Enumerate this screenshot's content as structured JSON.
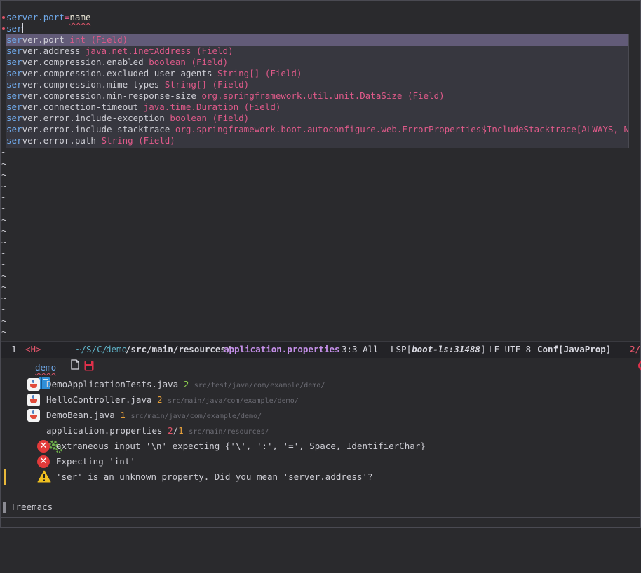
{
  "editor": {
    "line1": {
      "key": "server",
      "dot": ".",
      "key2": "port",
      "eq": "=",
      "value": "name"
    },
    "line2": {
      "text": "ser"
    },
    "completions": [
      {
        "match": "ser",
        "rest": "ver.port",
        "type": "int",
        "kind": "(Field)"
      },
      {
        "match": "ser",
        "rest": "ver.address",
        "type": "java.net.InetAddress",
        "kind": "(Field)"
      },
      {
        "match": "ser",
        "rest": "ver.compression.enabled",
        "type": "boolean",
        "kind": "(Field)"
      },
      {
        "match": "ser",
        "rest": "ver.compression.excluded-user-agents",
        "type": "String[]",
        "kind": "(Field)"
      },
      {
        "match": "ser",
        "rest": "ver.compression.mime-types",
        "type": "String[]",
        "kind": "(Field)"
      },
      {
        "match": "ser",
        "rest": "ver.compression.min-response-size",
        "type": "org.springframework.util.unit.DataSize",
        "kind": "(Field)"
      },
      {
        "match": "ser",
        "rest": "ver.connection-timeout",
        "type": "java.time.Duration",
        "kind": "(Field)"
      },
      {
        "match": "ser",
        "rest": "ver.error.include-exception",
        "type": "boolean",
        "kind": "(Field)"
      },
      {
        "match": "ser",
        "rest": "ver.error.include-stacktrace",
        "type": "org.springframework.boot.autoconfigure.web.ErrorProperties$IncludeStacktrace[ALWAYS, NEVER, O",
        "kind": ""
      },
      {
        "match": "ser",
        "rest": "ver.error.path",
        "type": "String",
        "kind": "(Field)"
      }
    ],
    "tilde": "~"
  },
  "modeline": {
    "window_number": "1",
    "state": "<H>",
    "path_prefix": "~/S/C/",
    "path_demo": "demo",
    "path_mid": "/src/main/resources/",
    "filename": "application.properties",
    "position": "3:3 All",
    "lsp_prefix": "LSP[",
    "lsp_name": "boot-ls:31488",
    "lsp_suffix": "]",
    "encoding": "LF UTF-8",
    "mode": "Conf[JavaProp]",
    "errors": "2/"
  },
  "tree": {
    "project": "demo",
    "files": [
      {
        "name": "DemoApplicationTests.java",
        "count": "2",
        "path": "src/test/java/com/example/demo/"
      },
      {
        "name": "HelloController.java",
        "count": "2",
        "path": "src/main/java/com/example/demo/"
      },
      {
        "name": "DemoBean.java",
        "count": "1",
        "path": "src/main/java/com/example/demo/"
      },
      {
        "name": "application.properties",
        "count_err": "2",
        "count_sep": "/",
        "count_warn": "1",
        "path": "src/main/resources/"
      }
    ],
    "diagnostics": [
      {
        "text": "extraneous input '\\n' expecting {'\\', ':', '=', Space, IdentifierChar}"
      },
      {
        "text": "Expecting 'int'"
      },
      {
        "text": "'ser' is an unknown property. Did you mean 'server.address'?"
      }
    ]
  },
  "bottom": {
    "title": "Treemacs"
  },
  "colors": {
    "selection": "#625b78",
    "keyword": "#6fa8e8",
    "type": "#e05a8a",
    "error": "#e23a3a",
    "warning": "#e8b83a"
  }
}
